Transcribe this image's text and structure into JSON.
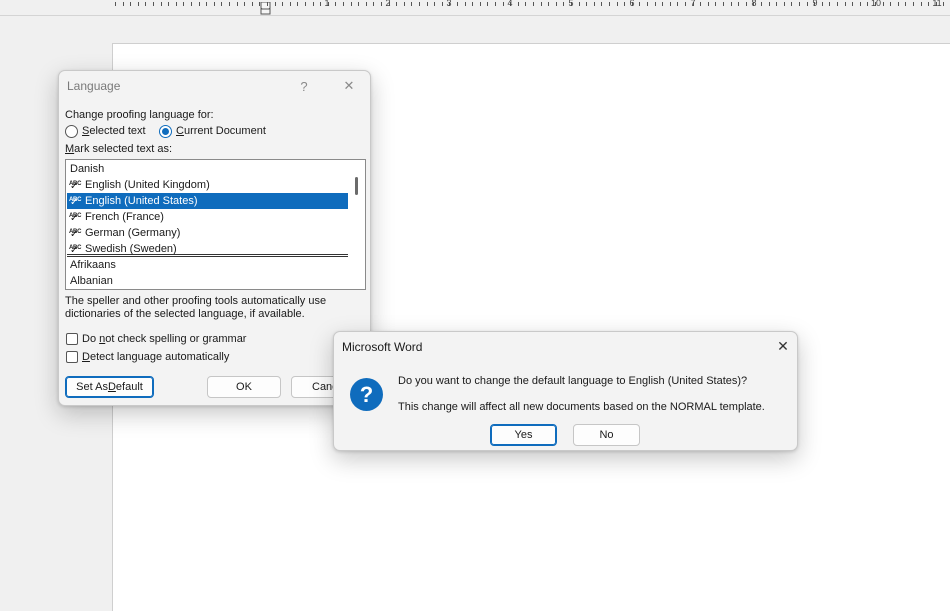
{
  "ruler": {
    "numbers": [
      "1",
      "2",
      "3",
      "4",
      "5",
      "6",
      "7",
      "8",
      "9",
      "10",
      "11"
    ]
  },
  "language_dialog": {
    "title": "Language",
    "help_glyph": "?",
    "close_glyph": "✕",
    "change_for_label": "Change proofing language for:",
    "radio_selected_text": "elected text",
    "radio_selected_text_accel": "S",
    "radio_current_document": "urrent Document",
    "radio_current_document_accel": "C",
    "radio_current_selected": "current_document",
    "mark_as_label_accel": "M",
    "mark_as_label": "ark selected text as:",
    "languages_top": [
      {
        "name": "Danish",
        "proofing": false
      },
      {
        "name": "English (United Kingdom)",
        "proofing": true
      },
      {
        "name": "English (United States)",
        "proofing": true,
        "selected": true
      },
      {
        "name": "French (France)",
        "proofing": true
      },
      {
        "name": "German (Germany)",
        "proofing": true
      },
      {
        "name": "Swedish (Sweden)",
        "proofing": true
      }
    ],
    "languages_rest": [
      "Afrikaans",
      "Albanian"
    ],
    "abc_glyph": "ABC",
    "check_glyph": "✓",
    "info_text_line1": "The speller and other proofing tools automatically use",
    "info_text_line2": "dictionaries of the selected language, if available.",
    "no_check_label_pre": "Do ",
    "no_check_label_accel": "n",
    "no_check_label_post": "ot check spelling or grammar",
    "detect_label_accel": "D",
    "detect_label_post": "etect language automatically",
    "set_default_pre": "Set As ",
    "set_default_accel": "D",
    "set_default_post": "efault",
    "ok_label": "OK",
    "cancel_label": "Canc"
  },
  "word_dialog": {
    "title": "Microsoft Word",
    "close_glyph": "✕",
    "question_glyph": "?",
    "message": "Do you want to change the default language to English (United States)?",
    "detail": "This change will affect all new documents based on the NORMAL template.",
    "yes_label": "Yes",
    "no_label": "No"
  },
  "colors": {
    "accent": "#0f6cbd",
    "page": "#ffffff",
    "background": "#f0f0f0"
  }
}
